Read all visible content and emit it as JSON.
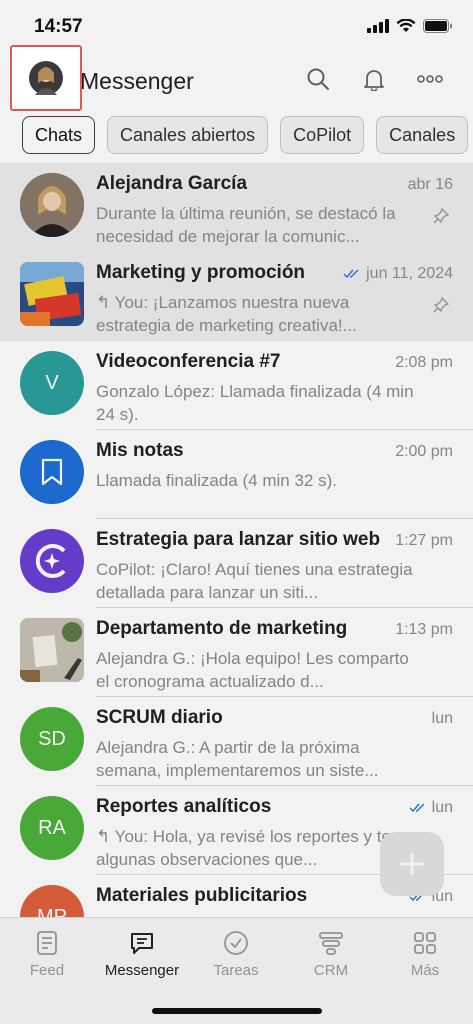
{
  "status_bar": {
    "time": "14:57",
    "icons": [
      "signal-icon",
      "wifi-icon",
      "battery-icon"
    ]
  },
  "header": {
    "title": "Messenger",
    "icons": [
      "search-icon",
      "bell-icon",
      "more-icon"
    ]
  },
  "filters": [
    {
      "label": "Chats",
      "active": true
    },
    {
      "label": "Canales abiertos",
      "active": false
    },
    {
      "label": "CoPilot",
      "active": false
    },
    {
      "label": "Canales",
      "active": false
    }
  ],
  "chats": [
    {
      "title": "Alejandra García",
      "time": "abr 16",
      "preview": "Durante la última reunión, se destacó la necesidad de mejorar la comunic...",
      "avatar": "photo",
      "pinned": true,
      "read": false
    },
    {
      "title": "Marketing y promoción",
      "time": "jun 11, 2024",
      "preview": "You: ¡Lanzamos nuestra nueva estrategia de marketing creativa!...",
      "avatar": "image",
      "pinned": true,
      "read": true,
      "reply": true
    },
    {
      "title": "Videoconferencia #7",
      "time": "2:08 pm",
      "preview": "Gonzalo López: Llamada finalizada (4 min 24 s).",
      "avatar": "V",
      "color": "#2aa19b"
    },
    {
      "title": "Mis notas",
      "time": "2:00 pm",
      "preview": "Llamada finalizada (4 min 32 s).",
      "avatar": "bookmark",
      "color": "#1e6fd9"
    },
    {
      "title": "Estrategia para lanzar sitio web",
      "time": "1:27 pm",
      "preview": "CoPilot: ¡Claro! Aquí tienes una estrategia detallada para lanzar un siti...",
      "avatar": "copilot",
      "color": "#6b3fd4"
    },
    {
      "title": "Departamento de marketing",
      "time": "1:13 pm",
      "preview": "Alejandra G.: ¡Hola equipo! Les comparto el cronograma actualizado d...",
      "avatar": "image2"
    },
    {
      "title": "SCRUM diario",
      "time": "lun",
      "preview": "Alejandra G.: A partir de la próxima semana, implementaremos un siste...",
      "avatar": "SD",
      "color": "#4db33c"
    },
    {
      "title": "Reportes analíticos",
      "time": "lun",
      "preview": "You: Hola, ya revisé los reportes y tengo algunas observaciones que...",
      "avatar": "RA",
      "color": "#4db33c",
      "read": true,
      "reply": true
    },
    {
      "title": "Materiales publicitarios",
      "time": "lun",
      "preview": "",
      "avatar": "MP",
      "color": "#e0603a",
      "read": true
    }
  ],
  "tabs": [
    {
      "label": "Feed",
      "icon": "feed-icon",
      "active": false
    },
    {
      "label": "Messenger",
      "icon": "chat-icon",
      "active": true
    },
    {
      "label": "Tareas",
      "icon": "check-circle-icon",
      "active": false
    },
    {
      "label": "CRM",
      "icon": "funnel-icon",
      "active": false
    },
    {
      "label": "Más",
      "icon": "grid-icon",
      "active": false
    }
  ]
}
